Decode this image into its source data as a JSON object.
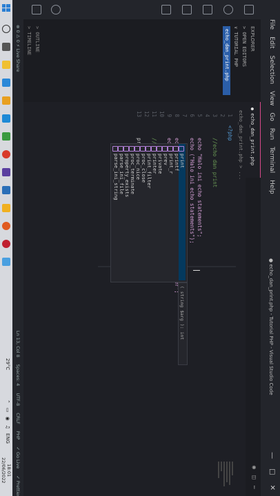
{
  "menu": [
    "File",
    "Edit",
    "Selection",
    "View",
    "Go",
    "Run",
    "Terminal",
    "Help"
  ],
  "window_title": "● echo_dan_print.php - Tutorial PHP - Visual Studio Code",
  "sidebar": {
    "header": "EXPLORER",
    "open_editors": "> OPEN EDITORS",
    "folder": "∨ TUTORIAL PHP",
    "file": "echo_dan_print.php",
    "outline": "> OUTLINE",
    "timeline": "> TIMELINE"
  },
  "tab": {
    "label": "● echo_dan_print.php"
  },
  "breadcrumb": "echo_dan_print.php > ...",
  "code_lines": [
    {
      "n": "1",
      "t": "<?php"
    },
    {
      "n": "2",
      "t": ""
    },
    {
      "n": "3",
      "t": "    //echo dan print"
    },
    {
      "n": "4",
      "t": ""
    },
    {
      "n": "5",
      "t": "    echo \"Halo ini echo statements\";"
    },
    {
      "n": "6",
      "t": "    echo (\"Halo ini echo statements\");"
    },
    {
      "n": "7",
      "t": ""
    },
    {
      "n": "8",
      "t": "    echo \"Aku\", \"Saya\", \"ini\", \"echo multi parameter\";"
    },
    {
      "n": "9",
      "t": "    echo \"<br>\";"
    },
    {
      "n": "10",
      "t": ""
    },
    {
      "n": "11",
      "t": "    //PHP Print Statements"
    },
    {
      "n": "12",
      "t": ""
    },
    {
      "n": "13",
      "t": "    pri"
    }
  ],
  "suggestions": [
    "print",
    "printf",
    "print_r",
    "prev",
    "private",
    "printer",
    "print_filter",
    "proc_close",
    "proc_nice",
    "proc_terminate",
    "property_exists",
    "parse_ini_file",
    "parse_ini_string"
  ],
  "suggest_detail": "( string $arg ): int",
  "status": {
    "left": "⊗ 0 ⚠ 0    ⚡ Live Share",
    "right": [
      "Ln 13, Col 8",
      "Spaces: 4",
      "UTF-8",
      "CRLF",
      "PHP",
      "✓ Go Live",
      "✓ Prettier"
    ]
  },
  "taskbar": {
    "weather": "29°C",
    "lang": "ENG",
    "time": "18:01",
    "date": "22/06/2022"
  }
}
